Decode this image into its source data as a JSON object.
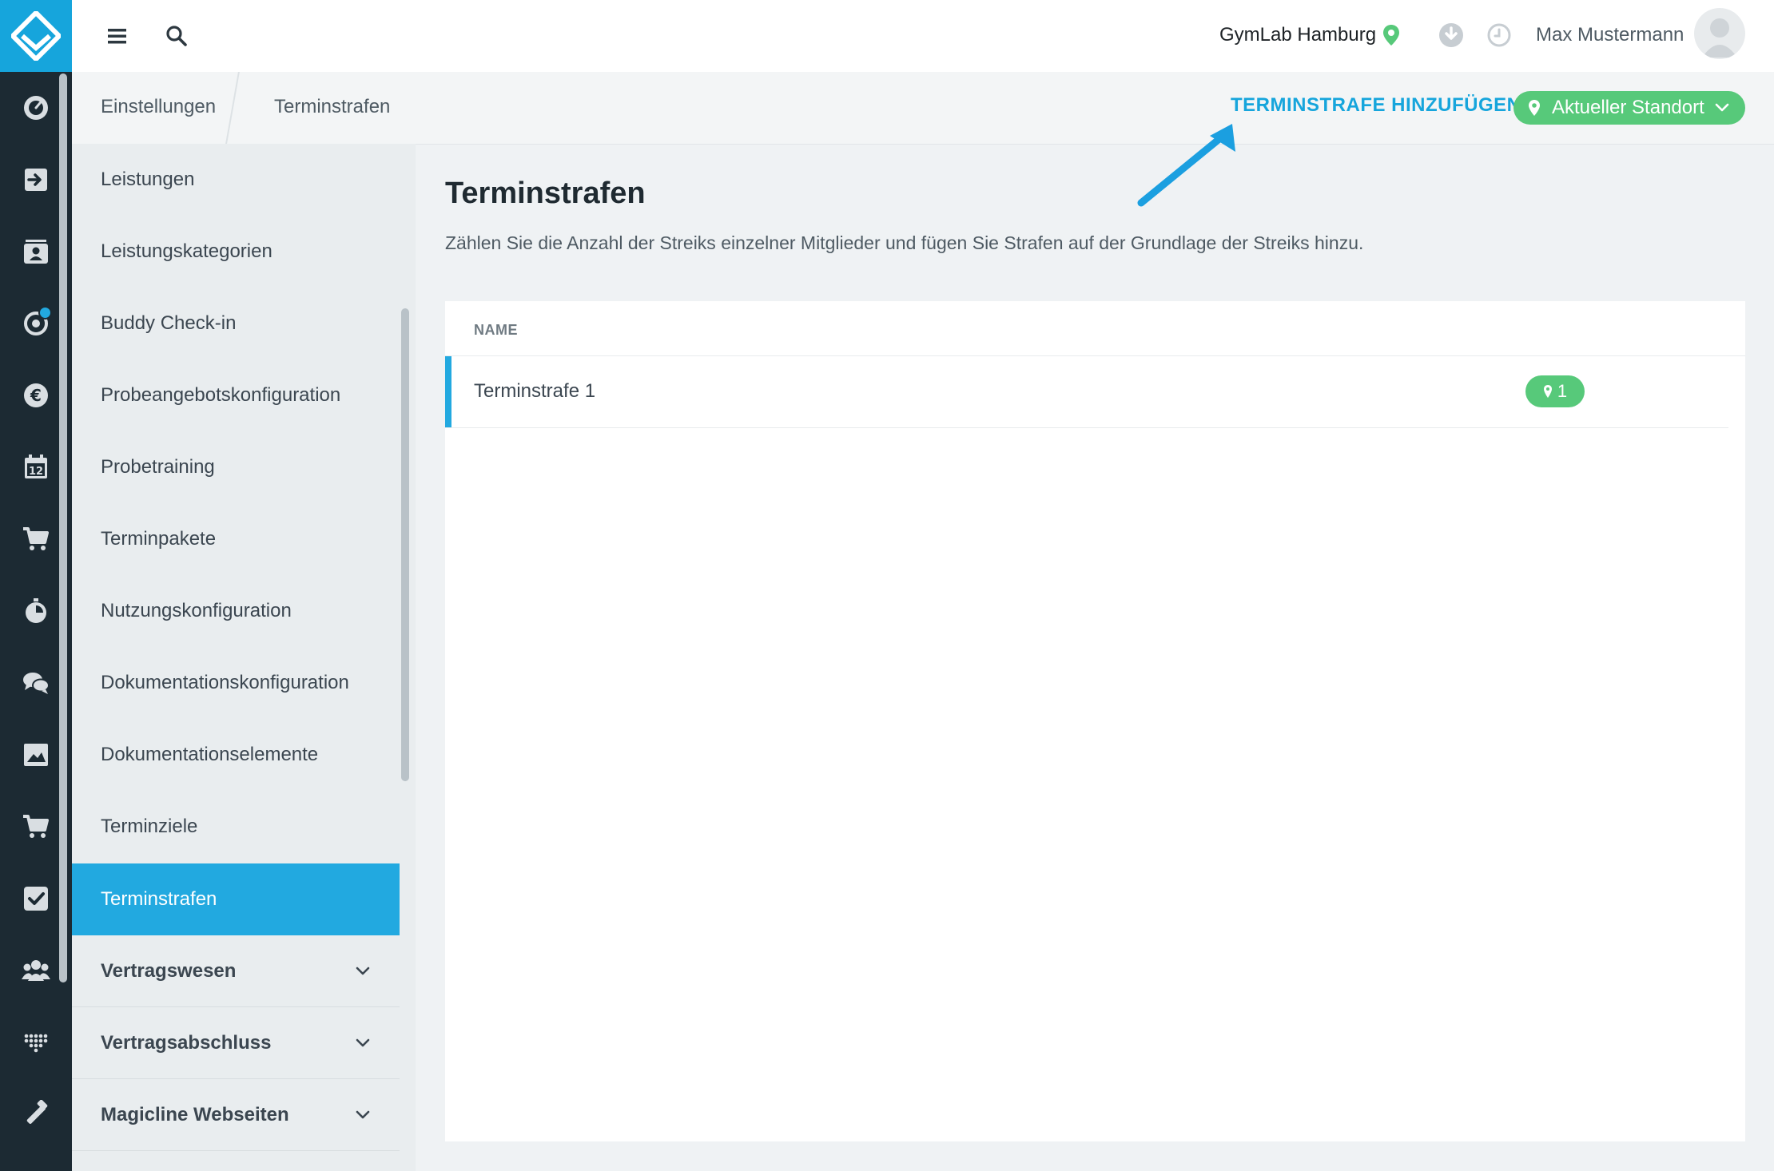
{
  "header": {
    "studio_name": "GymLab Hamburg",
    "user_name": "Max Mustermann"
  },
  "breadcrumb": {
    "items": [
      "Einstellungen",
      "Terminstrafen"
    ]
  },
  "actions": {
    "add_label": "TERMINSTRAFE HINZUFÜGEN",
    "location_label": "Aktueller Standort"
  },
  "sidebar": {
    "items": [
      {
        "label": "Leistungen"
      },
      {
        "label": "Leistungskategorien"
      },
      {
        "label": "Buddy Check-in"
      },
      {
        "label": "Probeangebotskonfiguration"
      },
      {
        "label": "Probetraining"
      },
      {
        "label": "Terminpakete"
      },
      {
        "label": "Nutzungskonfiguration"
      },
      {
        "label": "Dokumentationskonfiguration"
      },
      {
        "label": "Dokumentationselemente"
      },
      {
        "label": "Terminziele"
      },
      {
        "label": "Terminstrafen",
        "active": true
      }
    ],
    "groups": [
      {
        "label": "Vertragswesen"
      },
      {
        "label": "Vertragsabschluss"
      },
      {
        "label": "Magicline Webseiten"
      }
    ]
  },
  "main": {
    "title": "Terminstrafen",
    "description": "Zählen Sie die Anzahl der Streiks einzelner Mitglieder und fügen Sie Strafen auf der Grundlage der Streiks hinzu.",
    "table": {
      "column_name": "NAME",
      "rows": [
        {
          "name": "Terminstrafe 1",
          "location_count": "1"
        }
      ]
    }
  },
  "rail_icons": [
    "dashboard-icon",
    "checkin-icon",
    "members-icon",
    "target-icon",
    "euro-icon",
    "calendar-icon",
    "cart-icon",
    "stopwatch-icon",
    "chat-icon",
    "image-icon",
    "shop-icon",
    "checkbox-icon",
    "group-icon",
    "dots-grid-icon",
    "tools-icon"
  ],
  "colors": {
    "rail": "#1c2a33",
    "brand": "#16a5dc",
    "active_item": "#22a9e0",
    "green": "#57c97a"
  }
}
